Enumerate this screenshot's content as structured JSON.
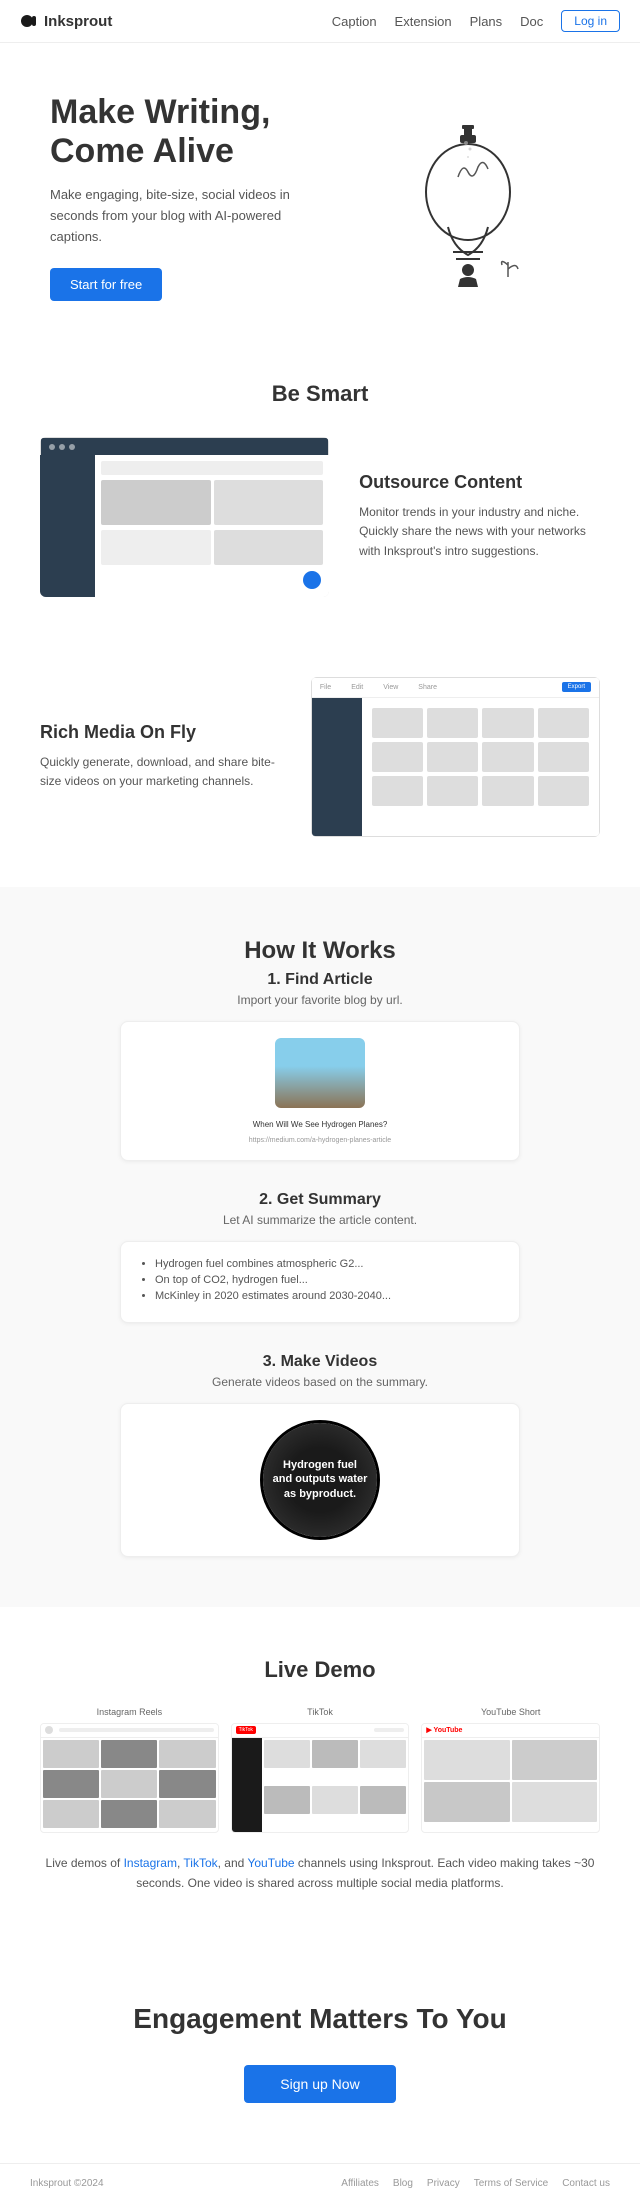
{
  "nav": {
    "logo": "Inksprout",
    "links": [
      "Caption",
      "Extension",
      "Plans",
      "Doc"
    ],
    "login": "Log in"
  },
  "hero": {
    "title": "Make Writing, Come Alive",
    "subtitle": "Make engaging, bite-size, social videos in seconds from your blog with AI-powered captions.",
    "cta": "Start for free"
  },
  "beSmart": {
    "section_title": "Be Smart",
    "feature_title": "Outsource Content",
    "feature_text": "Monitor trends in your industry and niche. Quickly share the news with your networks with Inksprout's intro suggestions."
  },
  "richMedia": {
    "title": "Rich Media On Fly",
    "text": "Quickly generate, download, and share bite-size videos on your marketing channels."
  },
  "howItWorks": {
    "title": "How It Works",
    "step1": {
      "title": "1. Find Article",
      "subtitle": "Import your favorite blog by url.",
      "article_title": "When Will We See Hydrogen Planes?",
      "article_url": "https://medium.com/a-hydrogen-planes-article"
    },
    "step2": {
      "title": "2. Get Summary",
      "subtitle": "Let AI summarize the article content.",
      "bullets": [
        "Hydrogen fuel combines atmospheric G2...",
        "On top of CO2, hydrogen fuel...",
        "McKinley in 2020 estimates around 2030-2040..."
      ]
    },
    "step3": {
      "title": "3. Make Videos",
      "subtitle": "Generate videos based on the summary.",
      "video_line1": "Hydrogen fuel",
      "video_line2": "and outputs water",
      "video_line3": "as byproduct."
    }
  },
  "liveDemo": {
    "title": "Live Demo",
    "labels": [
      "Instagram Reels",
      "TikTok",
      "YouTube Short"
    ],
    "description": "Live demos of Instagram, TikTok, and YouTube channels using Inksprout. Each video making takes ~30 seconds. One video is shared across multiple social media platforms."
  },
  "engagement": {
    "title": "Engagement Matters To You",
    "cta": "Sign up Now"
  },
  "footer": {
    "copyright": "Inksprout ©2024",
    "links": [
      "Affiliates",
      "Blog",
      "Privacy",
      "Terms of Service",
      "Contact us"
    ]
  }
}
